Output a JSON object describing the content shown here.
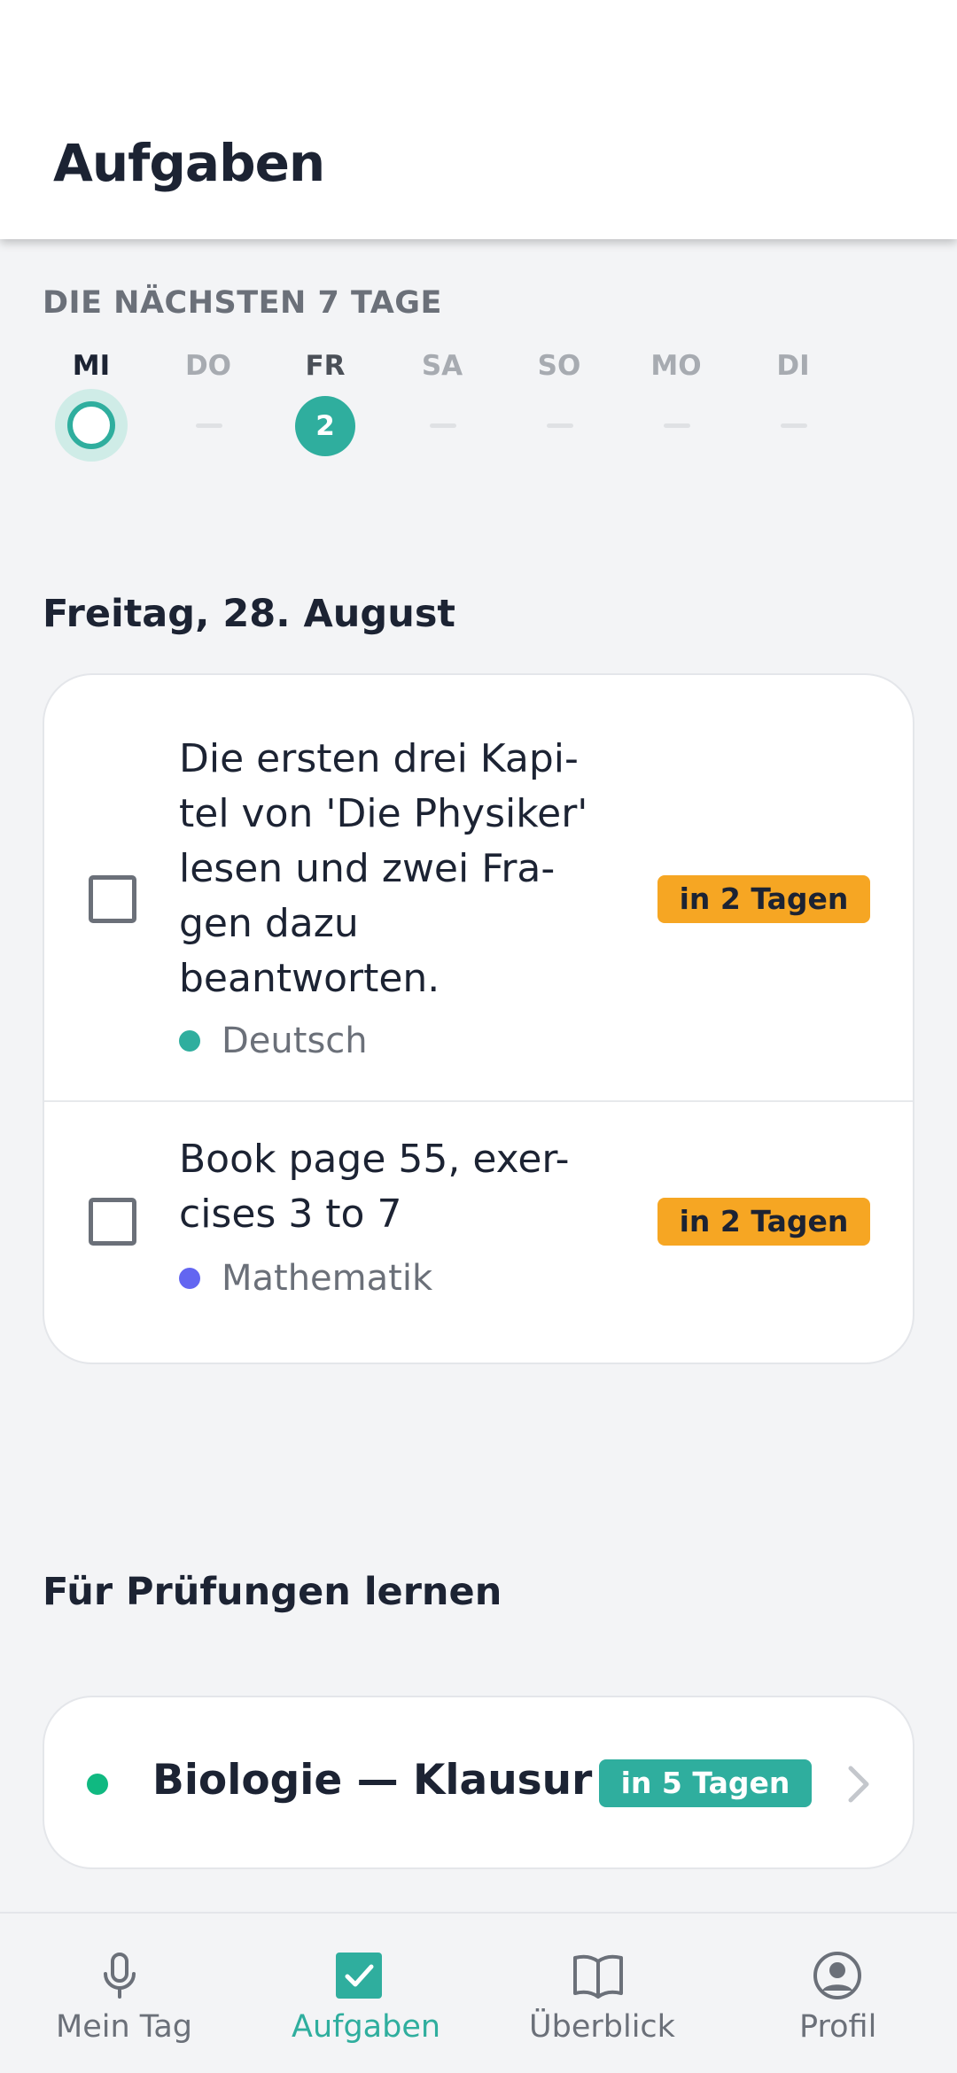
{
  "header": {
    "title": "Aufgaben"
  },
  "week": {
    "label": "DIE NÄCHSTEN 7 TAGE",
    "days": [
      {
        "name": "MI",
        "state": "today",
        "count": null
      },
      {
        "name": "DO",
        "state": "empty",
        "count": null
      },
      {
        "name": "FR",
        "state": "has-tasks",
        "count": "2"
      },
      {
        "name": "SA",
        "state": "empty",
        "count": null
      },
      {
        "name": "SO",
        "state": "empty",
        "count": null
      },
      {
        "name": "MO",
        "state": "empty",
        "count": null
      },
      {
        "name": "DI",
        "state": "empty",
        "count": null
      }
    ]
  },
  "day_section": {
    "heading": "Freitag, 28. August",
    "tasks": [
      {
        "title_lines": [
          "Die ersten drei Kapi-",
          "tel von 'Die Physiker'",
          "lesen und zwei Fra-",
          "gen dazu",
          "beantworten."
        ],
        "subject": "Deutsch",
        "subject_color": "#2fae9e",
        "due": "in 2 Tagen",
        "done": false
      },
      {
        "title_lines": [
          "Book page 55, exer-",
          "cises 3 to 7"
        ],
        "subject": "Mathematik",
        "subject_color": "#6366f1",
        "due": "in 2 Tagen",
        "done": false
      }
    ]
  },
  "exams": {
    "heading": "Für Prüfungen lernen",
    "items": [
      {
        "title": "Biologie — Klausur",
        "due": "in 5 Tagen",
        "subject_color": "#10b981"
      }
    ]
  },
  "nav": {
    "items": [
      {
        "label": "Mein Tag",
        "icon": "microphone-icon",
        "active": false
      },
      {
        "label": "Aufgaben",
        "icon": "checkbox-icon",
        "active": true
      },
      {
        "label": "Überblick",
        "icon": "book-icon",
        "active": false
      },
      {
        "label": "Profil",
        "icon": "profile-icon",
        "active": false
      }
    ]
  },
  "colors": {
    "accent": "#2fae9e",
    "due_soon": "#f6a623",
    "background": "#f3f4f6"
  }
}
